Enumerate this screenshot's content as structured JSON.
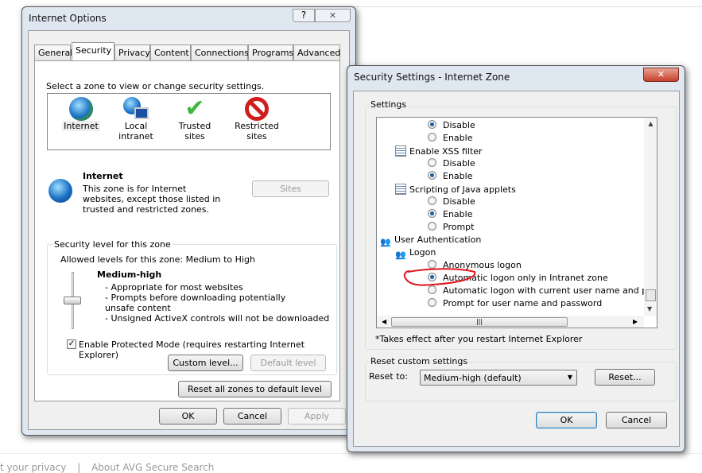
{
  "background": {
    "footer_links": [
      "t your privacy",
      "About AVG Secure Search"
    ]
  },
  "internet_options": {
    "title": "Internet Options",
    "help_label": "?",
    "close_label": "✕",
    "tabs": [
      "General",
      "Security",
      "Privacy",
      "Content",
      "Connections",
      "Programs",
      "Advanced"
    ],
    "active_tab": "Security",
    "zone_prompt": "Select a zone to view or change security settings.",
    "zones": [
      {
        "label": "Internet",
        "icon": "globe-icon"
      },
      {
        "label": "Local intranet",
        "icon": "intranet-icon"
      },
      {
        "label": "Trusted sites",
        "icon": "checkmark-icon"
      },
      {
        "label": "Restricted sites",
        "icon": "restricted-icon"
      }
    ],
    "zone_name": "Internet",
    "zone_desc": "This zone is for Internet websites, except those listed in trusted and restricted zones.",
    "sites_label": "Sites",
    "level_group": "Security level for this zone",
    "allowed_levels": "Allowed levels for this zone: Medium to High",
    "level_name": "Medium-high",
    "level_items": [
      "- Appropriate for most websites",
      "- Prompts before downloading potentially unsafe content",
      "- Unsigned ActiveX controls will not be downloaded"
    ],
    "protected_mode": "Enable Protected Mode (requires restarting Internet Explorer)",
    "protected_mode_checked": true,
    "custom_level": "Custom level...",
    "default_level": "Default level",
    "reset_all": "Reset all zones to default level",
    "ok": "OK",
    "cancel": "Cancel",
    "apply": "Apply"
  },
  "security_settings": {
    "title": "Security Settings - Internet Zone",
    "close_label": "✕",
    "settings_group": "Settings",
    "rows": [
      {
        "text": "Disable",
        "type": "radio",
        "checked": true,
        "indent": 2
      },
      {
        "text": "Enable",
        "type": "radio",
        "checked": false,
        "indent": 2
      },
      {
        "text": "Enable XSS filter",
        "type": "heading",
        "indent": 1
      },
      {
        "text": "Disable",
        "type": "radio",
        "checked": false,
        "indent": 2
      },
      {
        "text": "Enable",
        "type": "radio",
        "checked": true,
        "indent": 2
      },
      {
        "text": "Scripting of Java applets",
        "type": "heading",
        "indent": 1
      },
      {
        "text": "Disable",
        "type": "radio",
        "checked": false,
        "indent": 2
      },
      {
        "text": "Enable",
        "type": "radio",
        "checked": true,
        "indent": 2
      },
      {
        "text": "Prompt",
        "type": "radio",
        "checked": false,
        "indent": 2
      },
      {
        "text": "User Authentication",
        "type": "users",
        "indent": 0
      },
      {
        "text": "Logon",
        "type": "users",
        "indent": 1
      },
      {
        "text": "Anonymous logon",
        "type": "radio",
        "checked": false,
        "indent": 2
      },
      {
        "text": "Automatic logon only in Intranet zone",
        "type": "radio",
        "checked": true,
        "indent": 2
      },
      {
        "text": "Automatic logon with current user name and password",
        "type": "radio",
        "checked": false,
        "indent": 2
      },
      {
        "text": "Prompt for user name and password",
        "type": "radio",
        "checked": false,
        "indent": 2
      }
    ],
    "note": "*Takes effect after you restart Internet Explorer",
    "reset_group": "Reset custom settings",
    "reset_to_label": "Reset to:",
    "reset_to_value": "Medium-high (default)",
    "reset_button": "Reset...",
    "ok": "OK",
    "cancel": "Cancel",
    "annotation_color": "#e0161b"
  }
}
